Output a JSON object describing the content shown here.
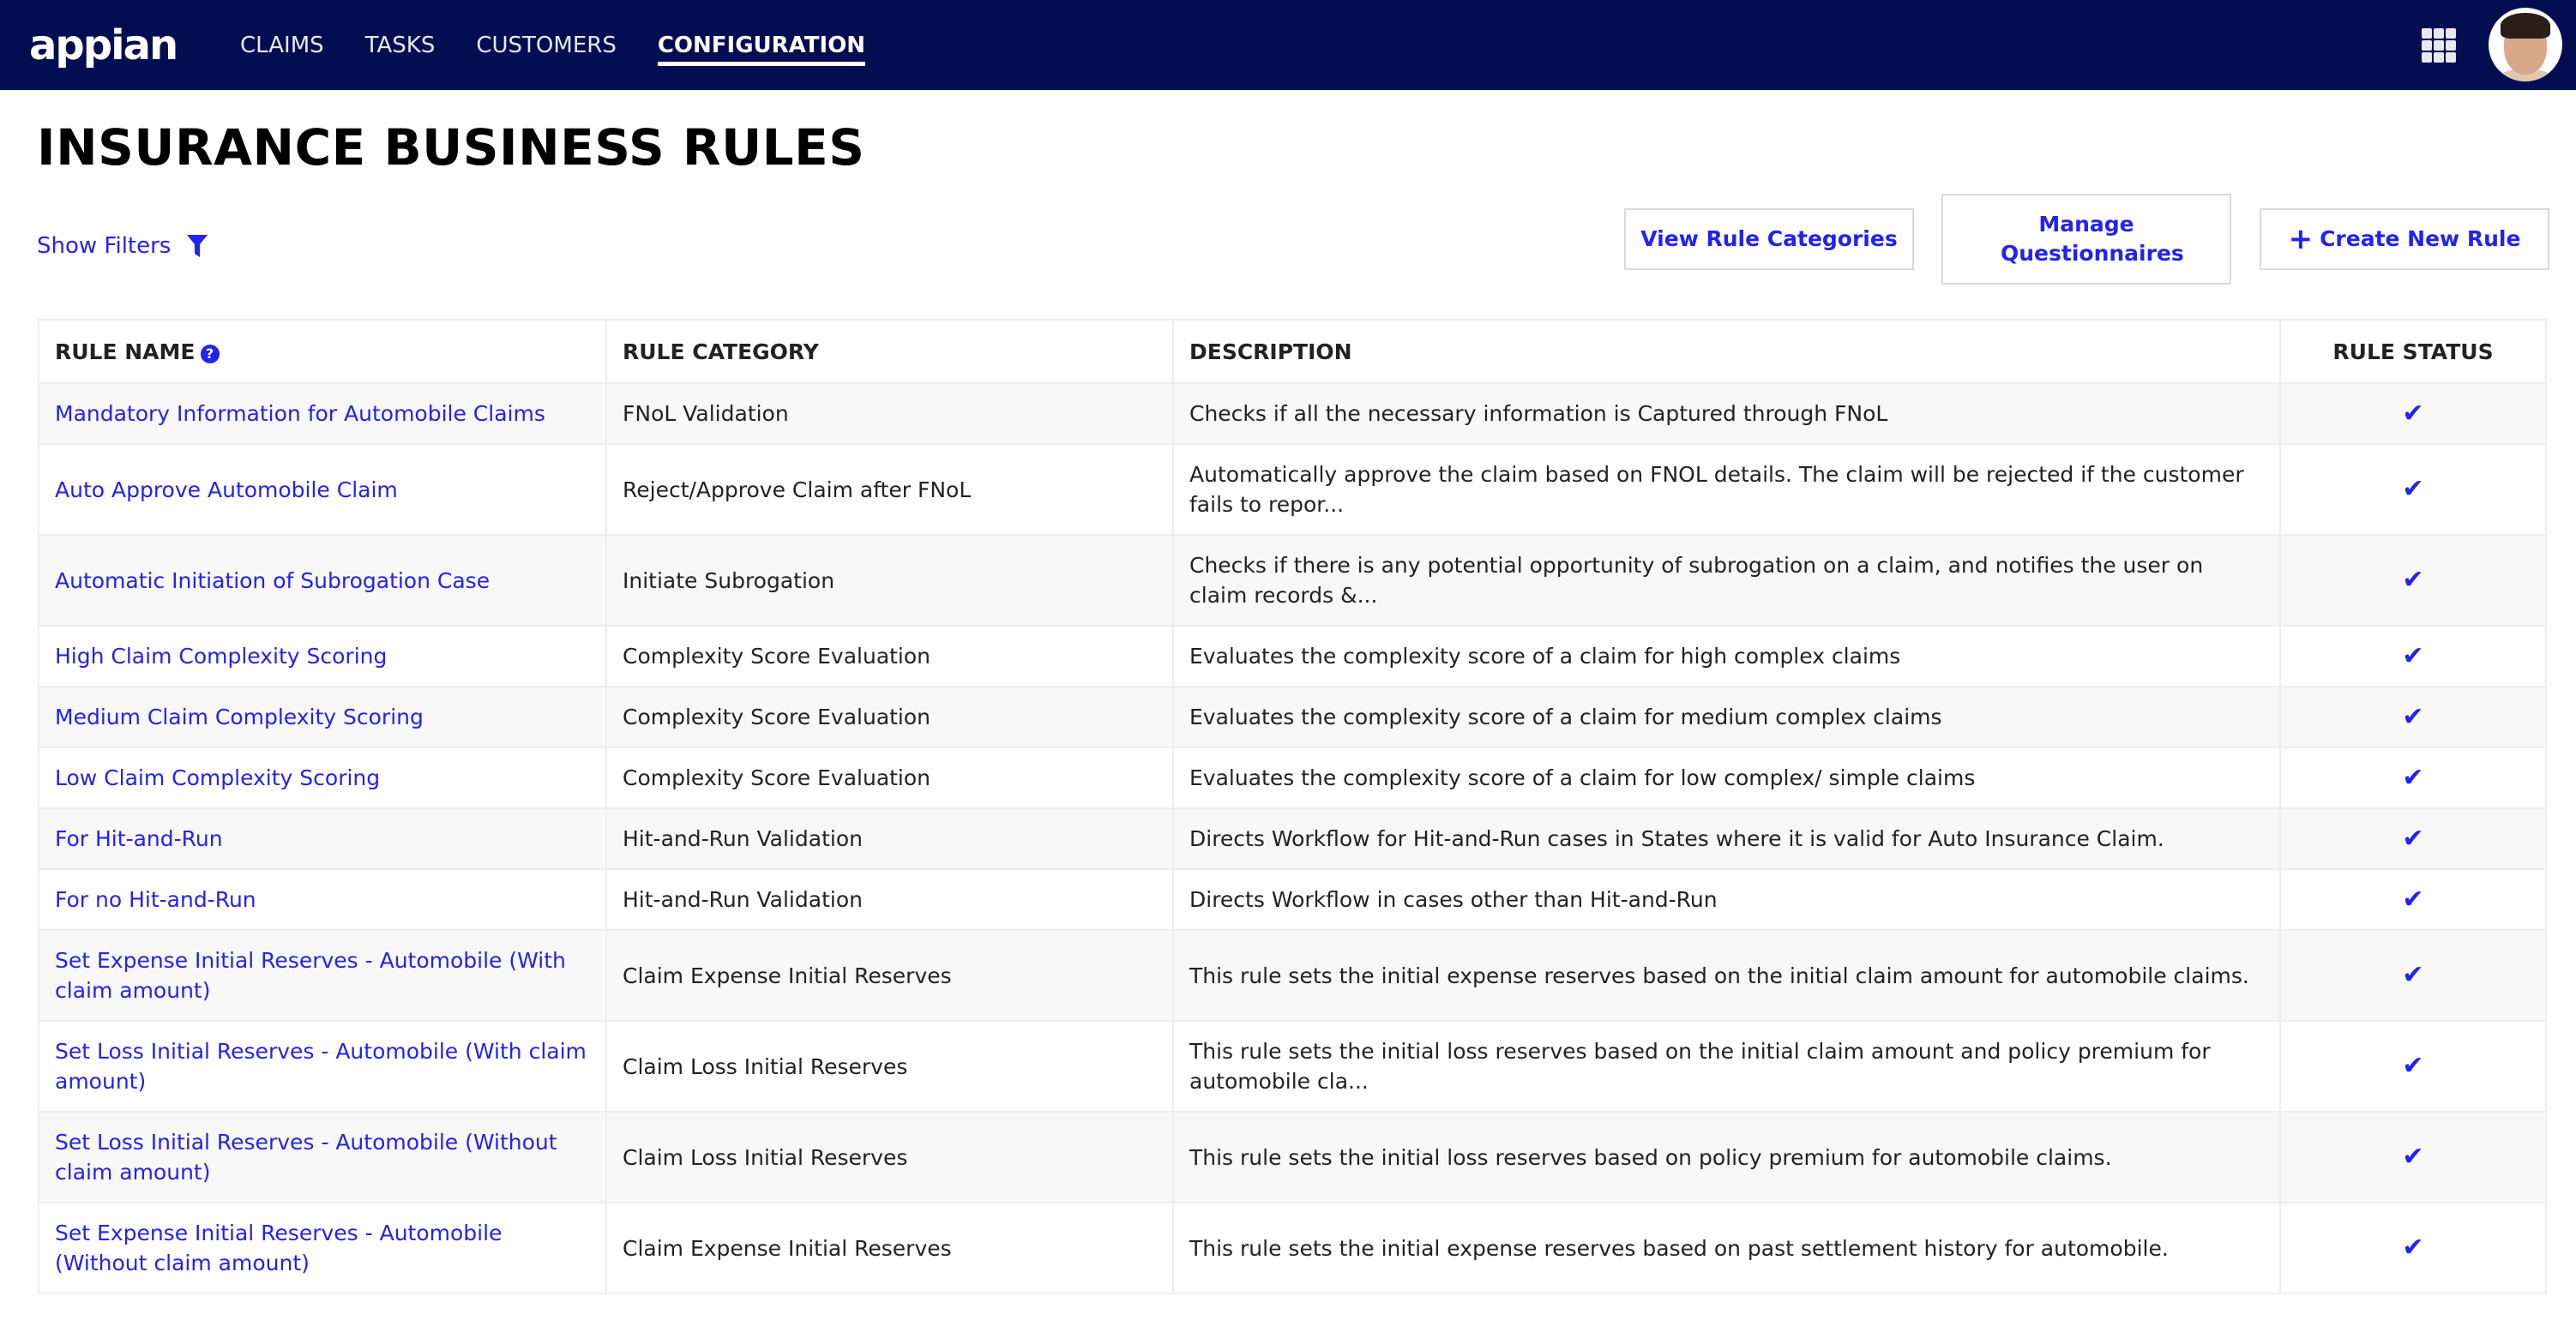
{
  "header": {
    "logo": "appian",
    "nav": [
      {
        "label": "CLAIMS",
        "active": false
      },
      {
        "label": "TASKS",
        "active": false
      },
      {
        "label": "CUSTOMERS",
        "active": false
      },
      {
        "label": "CONFIGURATION",
        "active": true
      }
    ],
    "apps_icon": "grid-icon",
    "avatar_icon": "user-avatar"
  },
  "page": {
    "title": "INSURANCE BUSINESS RULES",
    "show_filters_label": "Show Filters",
    "filter_icon": "funnel-icon"
  },
  "toolbar": {
    "view_categories_label": "View Rule Categories",
    "manage_questionnaires_label": "Manage Questionnaires",
    "create_rule_label": "Create New Rule",
    "create_rule_icon": "plus-icon"
  },
  "table": {
    "columns": [
      "RULE NAME",
      "RULE CATEGORY",
      "DESCRIPTION",
      "RULE STATUS"
    ],
    "help_icon": "?",
    "check_glyph": "✔",
    "rows": [
      {
        "name": "Mandatory Information for Automobile Claims",
        "category": "FNoL Validation",
        "description": "Checks if all the necessary information is Captured through FNoL",
        "status": "active"
      },
      {
        "name": "Auto Approve Automobile Claim",
        "category": "Reject/Approve Claim after FNoL",
        "description": "Automatically approve the claim based on FNOL details. The claim will be rejected if the customer fails to repor...",
        "status": "active"
      },
      {
        "name": "Automatic Initiation of Subrogation Case",
        "category": "Initiate Subrogation",
        "description": "Checks if there is any potential opportunity of subrogation on a claim, and notifies the user on claim records &...",
        "status": "active"
      },
      {
        "name": "High Claim Complexity Scoring",
        "category": "Complexity Score Evaluation",
        "description": "Evaluates the complexity score of a claim for high complex claims",
        "status": "active"
      },
      {
        "name": "Medium Claim Complexity Scoring",
        "category": "Complexity Score Evaluation",
        "description": "Evaluates the complexity score of a claim for medium complex claims",
        "status": "active"
      },
      {
        "name": "Low Claim Complexity Scoring",
        "category": "Complexity Score Evaluation",
        "description": "Evaluates the complexity score of a claim for low complex/ simple claims",
        "status": "active"
      },
      {
        "name": "For Hit-and-Run",
        "category": "Hit-and-Run Validation",
        "description": "Directs Workflow for Hit-and-Run cases in States where it is valid for Auto Insurance Claim.",
        "status": "active"
      },
      {
        "name": "For no Hit-and-Run",
        "category": "Hit-and-Run Validation",
        "description": "Directs Workflow in cases other than Hit-and-Run",
        "status": "active"
      },
      {
        "name": "Set Expense Initial Reserves - Automobile (With claim amount)",
        "category": "Claim Expense Initial Reserves",
        "description": "This rule sets the initial expense reserves based on the initial claim amount for automobile claims.",
        "status": "active"
      },
      {
        "name": "Set Loss Initial Reserves - Automobile (With claim amount)",
        "category": "Claim Loss Initial Reserves",
        "description": "This rule sets the initial loss reserves based on the initial claim amount and policy premium for automobile cla...",
        "status": "active"
      },
      {
        "name": "Set Loss Initial Reserves - Automobile (Without claim amount)",
        "category": "Claim Loss Initial Reserves",
        "description": "This rule sets the initial loss reserves based on policy premium for automobile claims.",
        "status": "active"
      },
      {
        "name": "Set Expense Initial Reserves - Automobile (Without claim amount)",
        "category": "Claim Expense Initial Reserves",
        "description": "This rule sets the initial expense reserves based on past settlement history for automobile.",
        "status": "active"
      }
    ]
  },
  "colors": {
    "header_bg": "#030e52",
    "accent": "#2322f0",
    "row_alt": "#f8f8f8",
    "border": "#eeeeee"
  }
}
